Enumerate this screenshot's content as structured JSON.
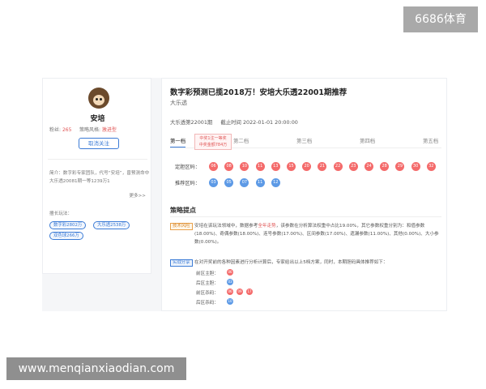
{
  "watermarks": {
    "top_right": "6686体育",
    "bottom_left": "www.menqianxiaodian.com"
  },
  "profile": {
    "name": "安培",
    "stats": {
      "fans_label": "粉丝:",
      "fans_value": "265",
      "hit_label": "策略风格:",
      "hit_value": "激进型"
    },
    "follow_label": "取消关注",
    "intro": "简介：数字彩专家团队，代号“安培”，曾预测命中大乐透20081期一等1239万1",
    "more_label": "更多>>",
    "tags_label": "擅长玩法：",
    "tags": [
      "数字彩2802万",
      "大乐透2538万",
      "双色球266万"
    ]
  },
  "article": {
    "title": "数字彩预测已揽2018万！安培大乐透22001期推荐",
    "author": "大乐透",
    "issue": "大乐透第22001期",
    "deadline_label": "截止时间",
    "deadline_value": "2022-01-01 20:00:00",
    "tabs": [
      "第一档",
      "第二档",
      "第三档",
      "第四档",
      "第五档"
    ],
    "tip": {
      "line1": "中奖1注一等奖",
      "line2": "中奖金额784万"
    },
    "front_label": "定胆区码：",
    "front_numbers": [
      "06",
      "08",
      "10",
      "11",
      "13",
      "15",
      "20",
      "21",
      "22",
      "23",
      "24",
      "28",
      "29",
      "30",
      "32"
    ],
    "back_label": "推荐区码：",
    "back_numbers": [
      "03",
      "05",
      "07",
      "11",
      "12"
    ],
    "section_title": "策略提点",
    "badge1": "技术风险",
    "para1_a": "安培在该玩法领域中，数据参考",
    "para1_hl": "全年走势",
    "para1_b": "，该参数在分析算法权重中占比19.00%，其它参数权重分别为：和值参数(18.00%)、奇偶参数(18.00%)、连号参数(17.00%)、区间参数(17.00%)、遗漏参数(11.00%)、其他(0.00%)、大小参数(0.00%)。",
    "badge2": "实战分享",
    "para2": "在对开奖前的各种因素进行分析计算后，专家给出以上5档方案，同时，本期胆码具体推荐如下：",
    "sub_rows": [
      {
        "label": "前区主胆：",
        "balls": [
          "06"
        ],
        "color": "red"
      },
      {
        "label": "后区主胆：",
        "balls": [
          "03"
        ],
        "color": "blue"
      },
      {
        "label": "前区杀码：",
        "balls": [
          "06",
          "09",
          "17"
        ],
        "color": "red"
      },
      {
        "label": "后区杀码：",
        "balls": [
          "10"
        ],
        "color": "blue"
      }
    ]
  },
  "colors": {
    "accent": "#3b7bd6",
    "red_ball": "#f46b6b",
    "blue_ball": "#5d9ae6",
    "highlight": "#e05555"
  }
}
